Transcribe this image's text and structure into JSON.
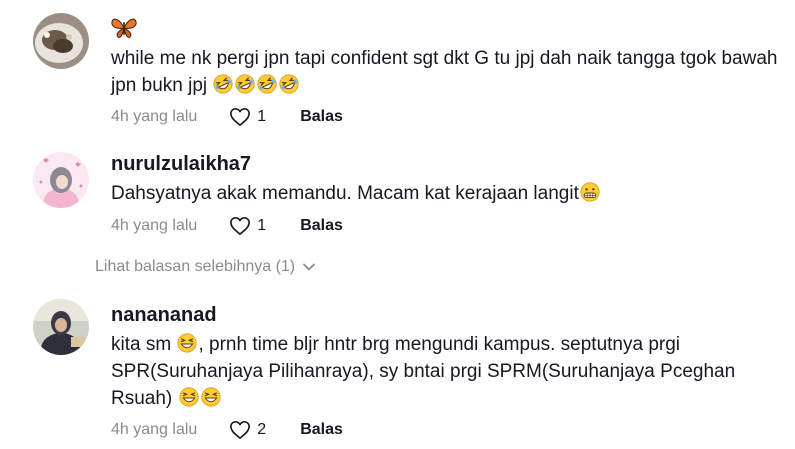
{
  "comments": [
    {
      "username": "",
      "text": "while me nk pergi jpn tapi confident sgt dkt G tu jpj dah naik tangga tgok bawah jpn bukn jpj",
      "emoji_name": "rolling-on-floor-laughing-emoji",
      "emoji_count": 4,
      "time": "4h yang lalu",
      "likes": "1",
      "reply_label": "Balas"
    },
    {
      "username": "nurulzulaikha7",
      "text": "Dahsyatnya akak memandu. Macam kat kerajaan langit",
      "emoji_name": "grimacing-face-emoji",
      "time": "4h yang lalu",
      "likes": "1",
      "reply_label": "Balas"
    },
    {
      "username": "nanananad",
      "text_part1": "kita sm ",
      "text_part2": ", prnh time bljr hntr brg mengundi kampus. septutnya prgi SPR(Suruhanjaya Pilihanraya), sy bntai prgi SPRM(Suruhanjaya Pceghan Rsuah) ",
      "emoji_name": "grinning-squinting-face-emoji",
      "time": "4h yang lalu",
      "likes": "2",
      "reply_label": "Balas"
    }
  ],
  "view_more_replies": "Lihat balasan selebihnya (1)",
  "colors": {
    "text": "#161823",
    "muted": "#8a8b91",
    "emoji_yellow": "#ffcc33",
    "butterfly": "#e8762b"
  }
}
